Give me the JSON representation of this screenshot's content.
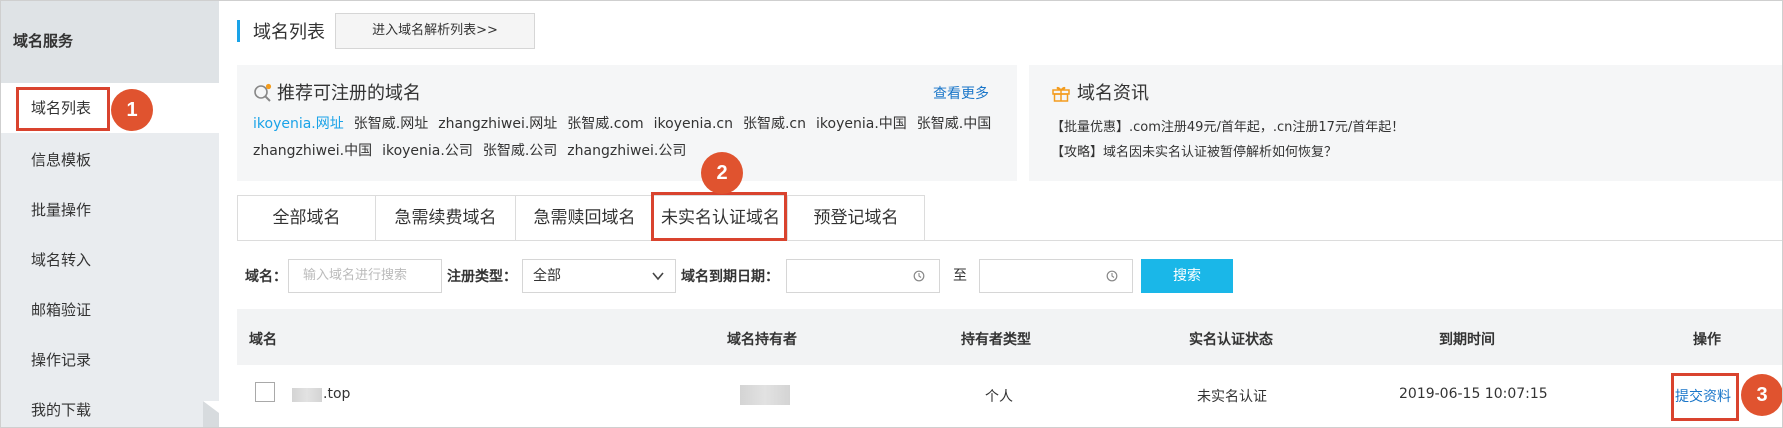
{
  "sidebar": {
    "title": "域名服务",
    "items": [
      {
        "label": "域名列表"
      },
      {
        "label": "信息模板"
      },
      {
        "label": "批量操作"
      },
      {
        "label": "域名转入"
      },
      {
        "label": "邮箱验证"
      },
      {
        "label": "操作记录"
      },
      {
        "label": "我的下载"
      }
    ]
  },
  "header": {
    "title": "域名列表",
    "dns_button": "进入域名解析列表>>"
  },
  "recommend": {
    "title": "推荐可注册的域名",
    "more": "查看更多",
    "domains": [
      "ikoyenia.网址",
      "张智威.网址",
      "zhangzhiwei.网址",
      "张智威.com",
      "ikoyenia.cn",
      "张智威.cn",
      "ikoyenia.中国",
      "张智威.中国",
      "zhangzhiwei.中国",
      "ikoyenia.公司",
      "张智威.公司",
      "zhangzhiwei.公司"
    ]
  },
  "news": {
    "title": "域名资讯",
    "items": [
      "【批量优惠】.com注册49元/首年起，.cn注册17元/首年起！",
      "【攻略】域名因未实名认证被暂停解析如何恢复？"
    ]
  },
  "tabs": [
    {
      "label": "全部域名"
    },
    {
      "label": "急需续费域名"
    },
    {
      "label": "急需赎回域名"
    },
    {
      "label": "未实名认证域名"
    },
    {
      "label": "预登记域名"
    }
  ],
  "filters": {
    "domain_label": "域名：",
    "domain_placeholder": "输入域名进行搜索",
    "type_label": "注册类型：",
    "type_value": "全部",
    "expire_label": "域名到期日期：",
    "to": "至",
    "search_button": "搜索"
  },
  "table": {
    "columns": [
      "域名",
      "域名持有者",
      "持有者类型",
      "实名认证状态",
      "到期时间",
      "操作"
    ],
    "rows": [
      {
        "domain_suffix": ".top",
        "holder_type": "个人",
        "status": "未实名认证",
        "expire": "2019-06-15 10:07:15",
        "action": "提交资料"
      }
    ]
  },
  "annotations": [
    "1",
    "2",
    "3"
  ],
  "colors": {
    "accent": "#1aa3e8",
    "search_button": "#1ab7e8",
    "annotation": "#d9432e",
    "link": "#1a76c9"
  }
}
